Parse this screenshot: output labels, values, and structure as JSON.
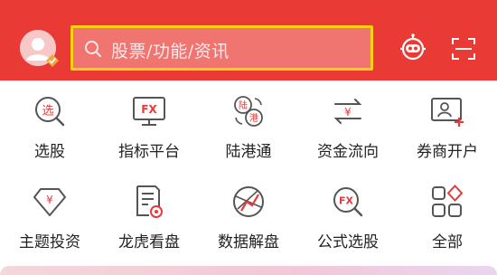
{
  "header": {
    "background_color": "#ea3a36",
    "avatar_icon": "user-avatar-icon",
    "search": {
      "placeholder": "股票/功能/资讯",
      "icon": "search-icon"
    },
    "robot_icon": "robot-assistant-icon",
    "scan_icon": "scan-icon"
  },
  "shortcuts": [
    {
      "label": "选股",
      "icon": "stock-picker-icon"
    },
    {
      "label": "指标平台",
      "icon": "fx-indicator-icon"
    },
    {
      "label": "陆港通",
      "icon": "hk-connect-icon"
    },
    {
      "label": "资金流向",
      "icon": "fund-flow-icon"
    },
    {
      "label": "券商开户",
      "icon": "open-account-icon"
    },
    {
      "label": "主题投资",
      "icon": "diamond-yen-icon"
    },
    {
      "label": "龙虎看盘",
      "icon": "dragon-tiger-icon"
    },
    {
      "label": "数据解盘",
      "icon": "data-chart-icon"
    },
    {
      "label": "公式选股",
      "icon": "fx-formula-icon"
    },
    {
      "label": "全部",
      "icon": "all-grid-icon"
    }
  ],
  "accent_colors": {
    "icon_red": "#e8393b",
    "icon_gray": "#555555",
    "search_border": "#f5d10f"
  }
}
